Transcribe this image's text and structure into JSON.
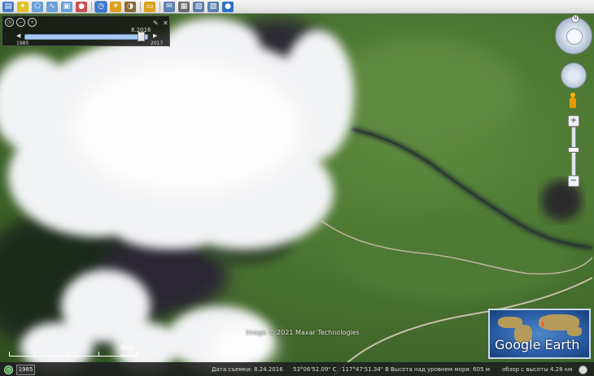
{
  "toolbar": {
    "buttons": [
      {
        "icon": "sidebar-icon",
        "color": "#4a7cc7"
      },
      {
        "icon": "placemark-icon",
        "color": "#e3c02a"
      },
      {
        "icon": "polygon-icon",
        "color": "#6aa0d8"
      },
      {
        "icon": "path-icon",
        "color": "#6aa0d8"
      },
      {
        "icon": "overlay-icon",
        "color": "#6aa0d8"
      },
      {
        "icon": "tour-icon",
        "color": "#c85050"
      },
      {
        "icon": "history-icon",
        "color": "#3d78c8",
        "active": true
      },
      {
        "icon": "sun-icon",
        "color": "#d8a21f"
      },
      {
        "icon": "planets-icon",
        "color": "#8a6a3a"
      },
      {
        "icon": "ruler-icon",
        "color": "#d8a21f"
      },
      {
        "icon": "email-icon",
        "color": "#5c7fb0"
      },
      {
        "icon": "print-icon",
        "color": "#6b6b6b"
      },
      {
        "icon": "save-image-icon",
        "color": "#5c7fb0"
      },
      {
        "icon": "view-in-maps-icon",
        "color": "#5c7fb0"
      },
      {
        "icon": "earth-gallery-icon",
        "color": "#2d6fc9"
      }
    ]
  },
  "timeslider": {
    "current_date": "8.2016",
    "start_year": "1985",
    "end_year": "2017",
    "position": 0.95
  },
  "navigation": {
    "north_label": "N",
    "zoom_level": 0.45
  },
  "scale": {
    "label": "846 м"
  },
  "credit": "Image © 2021 Maxar Technologies",
  "logo": {
    "text": "Google Earth"
  },
  "status": {
    "year_badge": "1985",
    "image_date": "Дата съемки: 8.24.2016",
    "latitude": "53°06'52.09\" С",
    "longitude": "117°47'51.34\" В",
    "elevation": "Высота над уровнем моря:  605 м",
    "eye_alt": "обзор с высоты   4.28 км"
  }
}
